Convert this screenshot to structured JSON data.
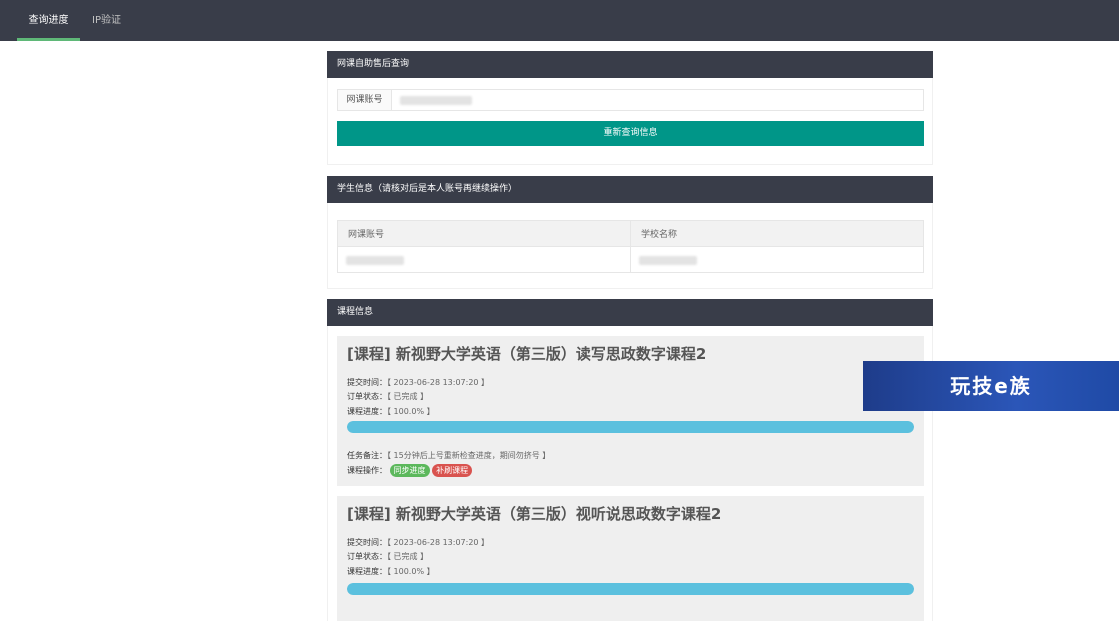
{
  "topnav": {
    "tabs": [
      {
        "label": "查询进度",
        "active": true
      },
      {
        "label": "IP验证",
        "active": false
      }
    ]
  },
  "query_panel": {
    "header": "网课自助售后查询",
    "account_addon": "网课账号",
    "account_value": "",
    "requery_button": "重新查询信息"
  },
  "student_panel": {
    "header": "学生信息（请核对后是本人账号再继续操作）",
    "columns": [
      "网课账号",
      "学校名称"
    ]
  },
  "course_panel": {
    "header": "课程信息",
    "submit_label": "提交时间：",
    "status_label": "订单状态：",
    "progress_label": "课程进度：",
    "note_label": "任务备注：",
    "ops_label": "课程操作：",
    "sync_button": "同步进度",
    "rebrush_button": "补刷课程",
    "courses": [
      {
        "title": "[课程] 新视野大学英语（第三版）读写思政数字课程2",
        "submit_time": "【 2023-06-28 13:07:20 】",
        "status": "【 已完成 】",
        "progress_text": "【 100.0% 】",
        "progress": 100,
        "note": "【 15分钟后上号重新检查进度，期间勿挤号 】"
      },
      {
        "title": "[课程] 新视野大学英语（第三版）视听说思政数字课程2",
        "submit_time": "【 2023-06-28 13:07:20 】",
        "status": "【 已完成 】",
        "progress_text": "【 100.0% 】",
        "progress": 100
      }
    ]
  },
  "watermark": "玩技e族",
  "colors": {
    "nav_bg": "#393d49",
    "nav_active": "#5fb878",
    "primary_button": "#009688",
    "progress": "#5bc0de",
    "pill_green": "#5cb85c",
    "pill_red": "#d9534f"
  }
}
